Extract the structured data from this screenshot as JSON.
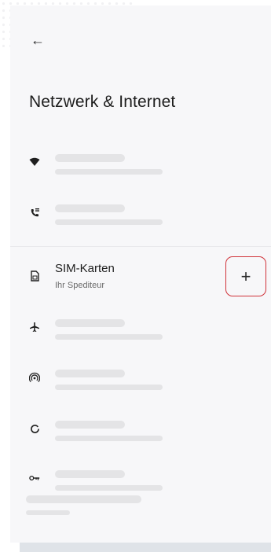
{
  "header": {
    "back_icon": "arrow-back-icon",
    "back_glyph": "←",
    "title": "Netzwerk & Internet"
  },
  "rows": [
    {
      "icon": "wifi-icon",
      "placeholder": true
    },
    {
      "icon": "phone-wifi-icon",
      "placeholder": true
    },
    {
      "icon": "sim-card-icon",
      "title": "SIM-Karten",
      "subtitle": "Ihr Spediteur"
    },
    {
      "icon": "airplane-icon",
      "placeholder": true
    },
    {
      "icon": "hotspot-icon",
      "placeholder": true
    },
    {
      "icon": "data-saver-icon",
      "placeholder": true
    },
    {
      "icon": "vpn-key-icon",
      "placeholder": true
    }
  ],
  "sim": {
    "title": "SIM-Karten",
    "subtitle": "Ihr Spediteur",
    "add_glyph": "+"
  },
  "colors": {
    "accent_outline": "#d0333a",
    "panel_bg": "#f7f7f9",
    "placeholder": "#e4e4e6"
  }
}
